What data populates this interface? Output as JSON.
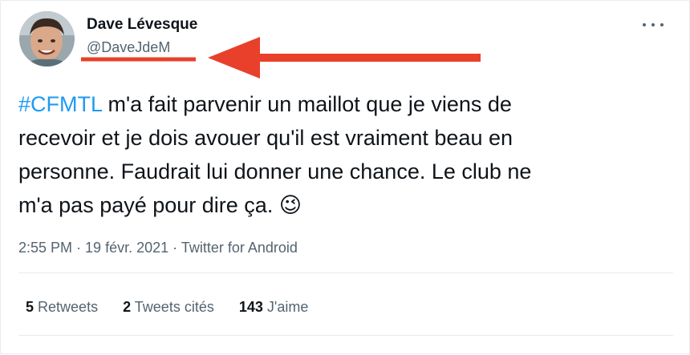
{
  "author": {
    "name": "Dave Lévesque",
    "handle": "@DaveJdeM"
  },
  "tweet": {
    "hashtag": "#CFMTL",
    "line1_rest": " m'a fait parvenir un maillot que je viens de",
    "line2": "recevoir et je dois avouer qu'il est vraiment beau en",
    "line3": "personne. Faudrait lui donner une chance. Le club ne",
    "line4": "m'a pas payé pour dire ça. ",
    "emoji": "😉"
  },
  "meta": {
    "time": "2:55 PM",
    "sep1": " · ",
    "date": "19 févr. 2021",
    "sep2": " · ",
    "source": "Twitter for Android"
  },
  "stats": {
    "retweets_count": "5",
    "retweets_label": "Retweets",
    "quotes_count": "2",
    "quotes_label": "Tweets cités",
    "likes_count": "143",
    "likes_label": "J'aime"
  },
  "icons": {
    "more": "more-horizontal-icon",
    "arrow": "red-arrow-annotation"
  },
  "colors": {
    "link": "#1d9bf0",
    "secondary": "#536471",
    "annotation": "#e8402b"
  }
}
